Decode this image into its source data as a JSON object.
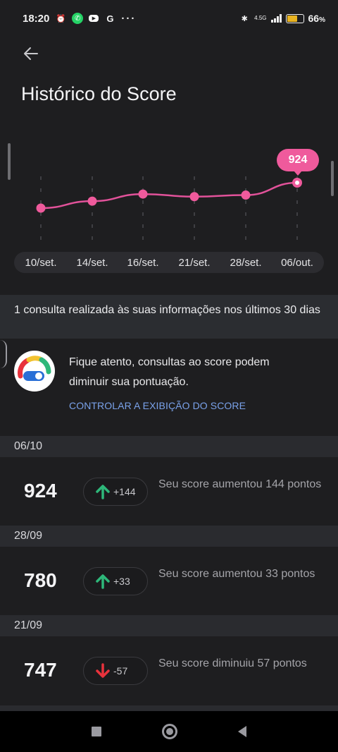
{
  "status_bar": {
    "time": "18:20",
    "battery_percent": "66",
    "battery_percent_symbol": "%",
    "network": "4.5G"
  },
  "header": {
    "title": "Histórico do Score"
  },
  "chart_data": {
    "type": "line",
    "categories": [
      "10/set.",
      "14/set.",
      "16/set.",
      "21/set.",
      "28/set.",
      "06/out."
    ],
    "values": [
      680,
      747,
      815,
      790,
      805,
      924
    ],
    "highlight": {
      "category": "06/out.",
      "label": "924"
    },
    "grid": true,
    "legend": "none",
    "colors": {
      "line": "#e2529a",
      "marker": "#ef5a9c",
      "tooltip": "#ef5a9c"
    }
  },
  "inquiry": {
    "text": "1 consulta realizada às suas informações nos últimos 30 dias"
  },
  "alert": {
    "text": "Fique atento, consultas ao score podem diminuir sua pontuação.",
    "link": "CONTROLAR A EXIBIÇÃO DO SCORE"
  },
  "history": [
    {
      "date": "06/10",
      "score": "924",
      "direction": "up",
      "delta": "+144",
      "description": "Seu score aumentou 144 pontos"
    },
    {
      "date": "28/09",
      "score": "780",
      "direction": "up",
      "delta": "+33",
      "description": "Seu score aumentou 33 pontos"
    },
    {
      "date": "21/09",
      "score": "747",
      "direction": "down",
      "delta": "-57",
      "description": "Seu score diminuiu 57 pontos"
    }
  ],
  "colors": {
    "up": "#2eb87a",
    "down": "#e8323c",
    "link": "#7aa2ea",
    "accent": "#ef5a9c"
  },
  "icons": {
    "back": "arrow-left-icon",
    "alert": "score-gauge-toggle-icon",
    "nav": [
      "recent-apps-icon",
      "home-icon",
      "back-triangle-icon"
    ]
  }
}
